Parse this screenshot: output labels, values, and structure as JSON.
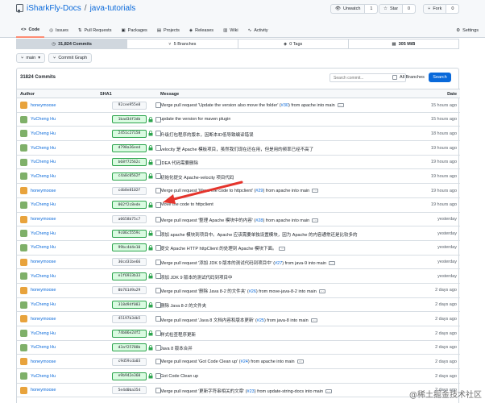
{
  "repo": {
    "owner": "iSharkFly-Docs",
    "separator": "/",
    "name": "java-tutorials"
  },
  "header_buttons": {
    "unwatch": {
      "label": "Unwatch",
      "count": "1"
    },
    "star": {
      "label": "Star",
      "count": "0"
    },
    "fork": {
      "label": "Fork",
      "count": "0"
    }
  },
  "tabs": [
    {
      "label": "Code",
      "icon": "code-icon"
    },
    {
      "label": "Issues",
      "icon": "issue-icon"
    },
    {
      "label": "Pull Requests",
      "icon": "pull-request-icon"
    },
    {
      "label": "Packages",
      "icon": "package-icon"
    },
    {
      "label": "Projects",
      "icon": "project-icon"
    },
    {
      "label": "Releases",
      "icon": "tag-icon"
    },
    {
      "label": "Wiki",
      "icon": "book-icon"
    },
    {
      "label": "Activity",
      "icon": "pulse-icon"
    }
  ],
  "settings_tab": "Settings",
  "stats": {
    "commits": "31,824 Commits",
    "branches": "5 Branches",
    "tags": "0 Tags",
    "size": "305 MiB"
  },
  "toolbar": {
    "branch": "main",
    "commit_graph": "Commit Graph"
  },
  "commit_box": {
    "count_label": "31824 Commits",
    "search_placeholder": "Search commit...",
    "all_branches": "All Branches",
    "search_button": "Search"
  },
  "table_headers": {
    "author": "Author",
    "sha": "SHA1",
    "message": "Message",
    "date": "Date"
  },
  "colors": {
    "accent": "#0969da",
    "verified": "#2da44e",
    "arrow": "#e5342c"
  },
  "commits": [
    {
      "author": "honeymoose",
      "sha": "92cee955e8",
      "verified": false,
      "msg": "Merge pull request 'Update the version also move the folder' (",
      "link": "#30",
      "tail": ") from apache into main",
      "more": true,
      "time": "15 hours ago"
    },
    {
      "author": "YuCheng Hu",
      "sha": "1bad34f3db",
      "verified": true,
      "msg": "update the version for maven plugin",
      "link": "",
      "tail": "",
      "more": false,
      "time": "15 hours ago"
    },
    {
      "author": "YuCheng Hu",
      "sha": "2451c27158",
      "verified": true,
      "msg": "升级打包程序的版本，因断本ID低导致编译错误",
      "link": "",
      "tail": "",
      "more": false,
      "time": "18 hours ago"
    },
    {
      "author": "YuCheng Hu",
      "sha": "d798a36eed",
      "verified": true,
      "msg": "velocity 是 Apache 模板项目，虽然我们现在还在用，但是用的频率已经不高了",
      "link": "",
      "tail": "",
      "more": false,
      "time": "19 hours ago"
    },
    {
      "author": "YuCheng Hu",
      "sha": "b68f72562c",
      "verified": true,
      "msg": "IDEA 代码需要删除",
      "link": "",
      "tail": "",
      "more": false,
      "time": "19 hours ago"
    },
    {
      "author": "YuCheng Hu",
      "sha": "c4a0c0562f",
      "verified": true,
      "msg": "初始化提交 Apache-velocity 项目代码",
      "link": "",
      "tail": "",
      "more": false,
      "time": "19 hours ago"
    },
    {
      "author": "honeymoose",
      "sha": "cdb8e8102f",
      "verified": false,
      "msg": "Merge pull request 'Move the code to httpclient' (",
      "link": "#29",
      "tail": ") from apache into main",
      "more": true,
      "time": "19 hours ago"
    },
    {
      "author": "YuCheng Hu",
      "sha": "002f2c8ede",
      "verified": true,
      "msg": "Move the code to httpclient",
      "link": "",
      "tail": "",
      "more": false,
      "time": "19 hours ago"
    },
    {
      "author": "honeymoose",
      "sha": "a0658b75c7",
      "verified": false,
      "msg": "Merge pull request '整理 Apache 模块中的内容' (",
      "link": "#28",
      "tail": ") from apache into main",
      "more": true,
      "time": "yesterday"
    },
    {
      "author": "YuCheng Hu",
      "sha": "9c06c5559c",
      "verified": true,
      "msg": "添加 apache 模块到项目中。Apache 应该需要单独设置模块，因为 Apache 的内容通常还是比较多的",
      "link": "",
      "tail": "",
      "more": false,
      "time": "yesterday"
    },
    {
      "author": "YuCheng Hu",
      "sha": "99bc4d4e10",
      "verified": true,
      "msg": "提交 Apache HTTP httpClient 的处理到 Apache 模块下面。",
      "link": "",
      "tail": "",
      "more": true,
      "time": "yesterday"
    },
    {
      "author": "honeymoose",
      "sha": "30cd31be66",
      "verified": false,
      "msg": "Merge pull request '添加 JDK 9 版本的测试代码到项目中' (",
      "link": "#27",
      "tail": ") from java-9 into main",
      "more": true,
      "time": "yesterday"
    },
    {
      "author": "YuCheng Hu",
      "sha": "e1f6933b33",
      "verified": true,
      "msg": "添加 JDK 9 版本的测试代码到项目中",
      "link": "",
      "tail": "",
      "more": false,
      "time": "yesterday"
    },
    {
      "author": "honeymoose",
      "sha": "0b76149a29",
      "verified": false,
      "msg": "Merge pull request '删除 Java 8-2 的文件夹' (",
      "link": "#26",
      "tail": ") from move-java-8-2 into main",
      "more": true,
      "time": "2 days ago"
    },
    {
      "author": "YuCheng Hu",
      "sha": "318d94f083",
      "verified": true,
      "msg": "删除 Java 8-2 的文件夹",
      "link": "",
      "tail": "",
      "more": false,
      "time": "2 days ago"
    },
    {
      "author": "honeymoose",
      "sha": "45197b3db5",
      "verified": false,
      "msg": "Merge pull request 'Java 8 文档内容和版本更新' (",
      "link": "#25",
      "tail": ") from java-8 into main",
      "more": true,
      "time": "2 days ago"
    },
    {
      "author": "YuCheng Hu",
      "sha": "74b06e2df2",
      "verified": true,
      "msg": "样式检查程序更新",
      "link": "",
      "tail": "",
      "more": false,
      "time": "2 days ago"
    },
    {
      "author": "YuCheng Hu",
      "sha": "d3af25788b",
      "verified": true,
      "msg": "Java 8 版本合并",
      "link": "",
      "tail": "",
      "more": false,
      "time": "2 days ago"
    },
    {
      "author": "honeymoose",
      "sha": "c9d59cda03",
      "verified": false,
      "msg": "Merge pull request 'Got Code Clean up' (",
      "link": "#24",
      "tail": ") from apache into main",
      "more": true,
      "time": "2 days ago"
    },
    {
      "author": "YuCheng Hu",
      "sha": "e9b942e360",
      "verified": true,
      "msg": "Got Code Clean up",
      "link": "",
      "tail": "",
      "more": false,
      "time": "2 days ago"
    },
    {
      "author": "honeymoose",
      "sha": "5e4d0ba354",
      "verified": false,
      "msg": "Merge pull request '更新字符串相关的文章' (",
      "link": "#23",
      "tail": ") from update-string-docs into main",
      "more": true,
      "time": "2 days ago"
    }
  ],
  "watermark": "@稀土掘金技术社区"
}
